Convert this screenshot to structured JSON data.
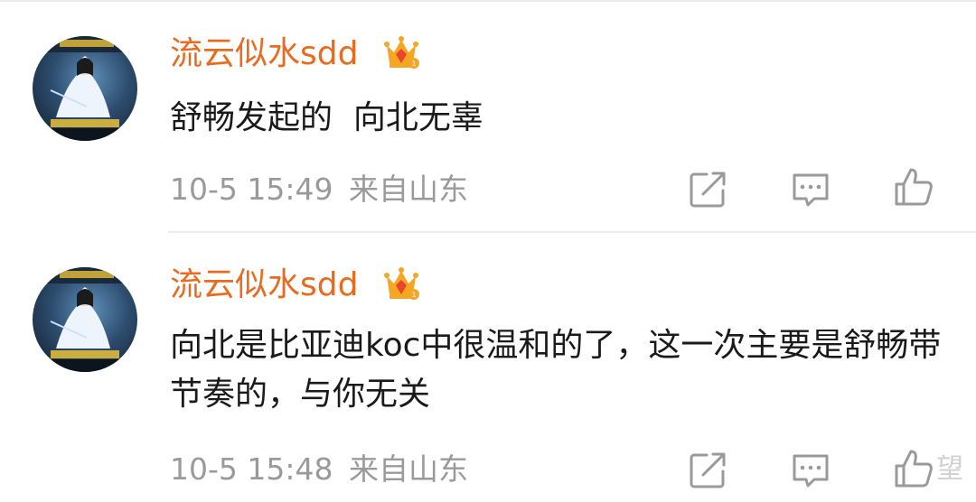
{
  "comments": [
    {
      "username": "流云似水sdd",
      "content": "舒畅发起的  向北无辜",
      "time": "10-5 15:49",
      "location": "来自山东"
    },
    {
      "username": "流云似水sdd",
      "content": "向北是比亚迪koc中很温和的了，这一次主要是舒畅带节奏的，与你无关",
      "time": "10-5 15:48",
      "location": "来自山东"
    }
  ],
  "icons": {
    "repost": "repost-icon",
    "comment": "comment-icon",
    "like": "like-icon",
    "vip": "vip-crown-icon"
  },
  "watermark": "望",
  "colors": {
    "username": "#e86b1f",
    "text": "#1a1a1a",
    "meta": "#9a9a9a",
    "divider": "#ececec",
    "crown": "#f5a623",
    "gem": "#e8452c"
  }
}
